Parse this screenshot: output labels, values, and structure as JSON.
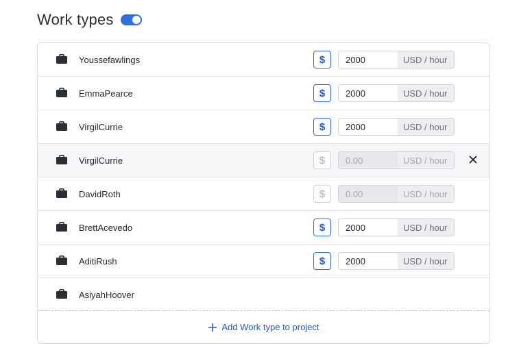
{
  "header": {
    "title": "Work types",
    "toggle_on": true
  },
  "colors": {
    "accent": "#2f6fde",
    "link": "#2458c6"
  },
  "rows": [
    {
      "name": "Youssefawlings",
      "rate": "2000",
      "unit": "USD / hour",
      "enabled": true,
      "highlight": false,
      "show_rate": true,
      "show_close": false
    },
    {
      "name": "EmmaPearce",
      "rate": "2000",
      "unit": "USD / hour",
      "enabled": true,
      "highlight": false,
      "show_rate": true,
      "show_close": false
    },
    {
      "name": "VirgilCurrie",
      "rate": "2000",
      "unit": "USD / hour",
      "enabled": true,
      "highlight": false,
      "show_rate": true,
      "show_close": false
    },
    {
      "name": "VirgilCurrie",
      "rate": "0.00",
      "unit": "USD / hour",
      "enabled": false,
      "highlight": true,
      "show_rate": true,
      "show_close": true
    },
    {
      "name": "DavidRoth",
      "rate": "0.00",
      "unit": "USD / hour",
      "enabled": false,
      "highlight": false,
      "show_rate": true,
      "show_close": false
    },
    {
      "name": "BrettAcevedo",
      "rate": "2000",
      "unit": "USD / hour",
      "enabled": true,
      "highlight": false,
      "show_rate": true,
      "show_close": false
    },
    {
      "name": "AditiRush",
      "rate": "2000",
      "unit": "USD / hour",
      "enabled": true,
      "highlight": false,
      "show_rate": true,
      "show_close": false
    },
    {
      "name": "AsiyahHoover",
      "rate": "",
      "unit": "",
      "enabled": false,
      "highlight": false,
      "show_rate": false,
      "show_close": false
    }
  ],
  "icons": {
    "row": "briefcase-icon",
    "rate_toggle": "dollar-icon",
    "remove": "close-icon",
    "add": "plus-icon"
  },
  "dollar_symbol": "$",
  "add_label": "Add Work type to project"
}
